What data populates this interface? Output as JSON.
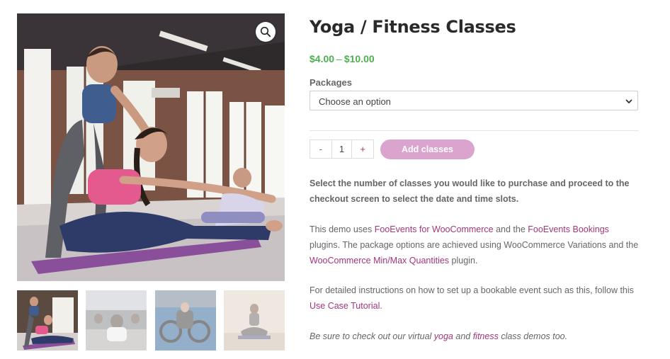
{
  "product": {
    "title": "Yoga / Fitness Classes",
    "price_min": "$4.00",
    "price_sep": "–",
    "price_max": "$10.00"
  },
  "gallery": {
    "zoom_icon": "magnifier-icon",
    "thumb_count": 4
  },
  "variations": {
    "label": "Packages",
    "selected": "Choose an option"
  },
  "cart": {
    "minus": "-",
    "quantity": "1",
    "plus": "+",
    "add_button": "Add classes"
  },
  "description": {
    "p1": "Select the number of classes you would like to purchase and proceed to the checkout screen to select the date and time slots.",
    "p2_a": "This demo uses ",
    "p2_link1": "FooEvents for WooCommerce",
    "p2_b": " and the ",
    "p2_link2": "FooEvents Bookings",
    "p2_c": " plugins. The package options are achieved using WooCommerce Variations and the ",
    "p2_link3": "WooCommerce Min/Max Quantities",
    "p2_d": " plugin.",
    "p3_a": "For detailed instructions on how to set up a bookable event such as this, follow this ",
    "p3_link": "Use Case Tutorial",
    "p3_b": ".",
    "p4_a": "Be sure to check out our virtual ",
    "p4_link1": "yoga",
    "p4_b": " and ",
    "p4_link2": "fitness",
    "p4_c": " class demos too."
  },
  "colors": {
    "price": "#4caf50",
    "link": "#a3367b",
    "button": "#dba4cf"
  }
}
